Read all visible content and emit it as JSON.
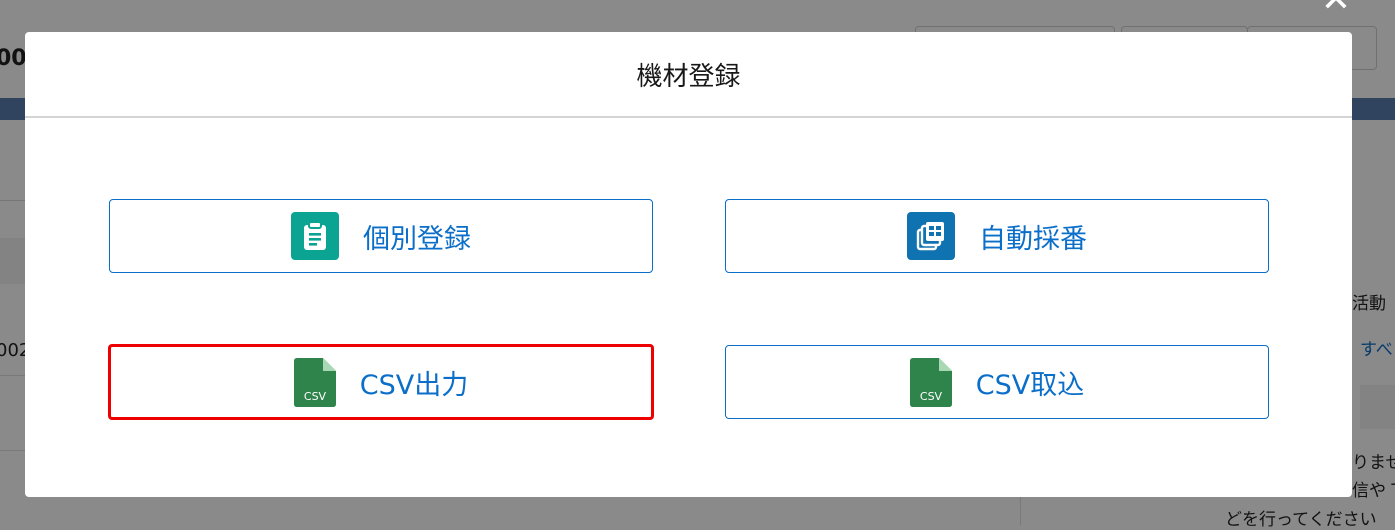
{
  "background": {
    "left_fragments": [
      "00",
      "002"
    ],
    "right_fragments": [
      "活動",
      "すべ",
      "りませ",
      "信や T",
      "どを行ってください"
    ]
  },
  "modal": {
    "title": "機材登録",
    "close_icon": "close-icon",
    "buttons": [
      {
        "id": "individual",
        "label": "個別登録",
        "icon": "clipboard-icon",
        "icon_color": "#0ba493",
        "highlighted": false
      },
      {
        "id": "auto-number",
        "label": "自動採番",
        "icon": "stacked-pages-icon",
        "icon_color": "#0f72b1",
        "highlighted": false
      },
      {
        "id": "csv-export",
        "label": "CSV出力",
        "icon": "csv-file-icon",
        "icon_text": "CSV",
        "icon_color": "#2e844a",
        "highlighted": true
      },
      {
        "id": "csv-import",
        "label": "CSV取込",
        "icon": "csv-file-icon",
        "icon_text": "CSV",
        "icon_color": "#2e844a",
        "highlighted": false
      }
    ]
  },
  "colors": {
    "accent": "#0b6ec9",
    "highlight": "#ee0000"
  }
}
